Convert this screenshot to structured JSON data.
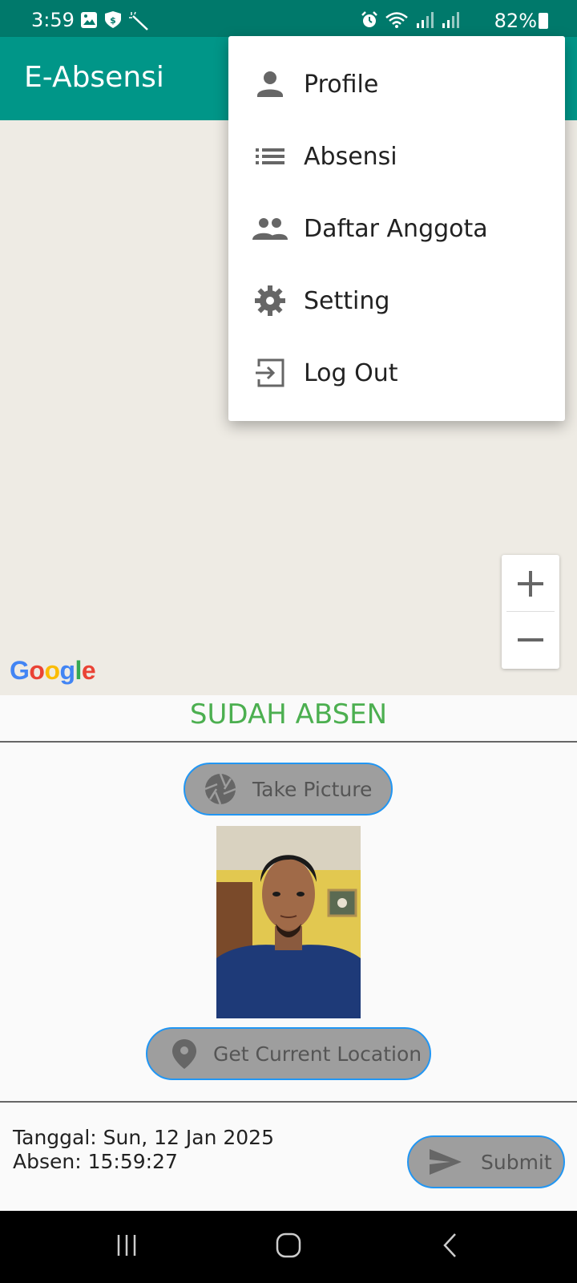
{
  "status_bar": {
    "time": "3:59",
    "battery": "82%",
    "left_icons": [
      "image-icon",
      "shield-dollar-icon",
      "magic-wand-icon"
    ],
    "right_icons": [
      "alarm-icon",
      "wifi-icon",
      "signal-icon",
      "signal-icon"
    ]
  },
  "app_bar": {
    "title": "E-Absensi"
  },
  "menu": {
    "items": [
      {
        "label": "Profile",
        "icon": "person-icon"
      },
      {
        "label": "Absensi",
        "icon": "list-icon"
      },
      {
        "label": "Daftar Anggota",
        "icon": "group-icon"
      },
      {
        "label": "Setting",
        "icon": "gear-icon"
      },
      {
        "label": "Log Out",
        "icon": "exit-icon"
      }
    ]
  },
  "map": {
    "zoom_in": "+",
    "zoom_out": "−",
    "attribution": "Google"
  },
  "attendance": {
    "status": "SUDAH ABSEN",
    "status_color": "#4caf50",
    "take_picture_label": "Take Picture",
    "get_location_label": "Get Current Location",
    "date_line": "Tanggal: Sun, 12 Jan 2025",
    "time_line": "Absen: 15:59:27",
    "submit_label": "Submit"
  },
  "colors": {
    "primary": "#009688",
    "primary_dark": "#00796b",
    "button_border": "#2196f3",
    "button_fill": "#9e9e9e"
  }
}
